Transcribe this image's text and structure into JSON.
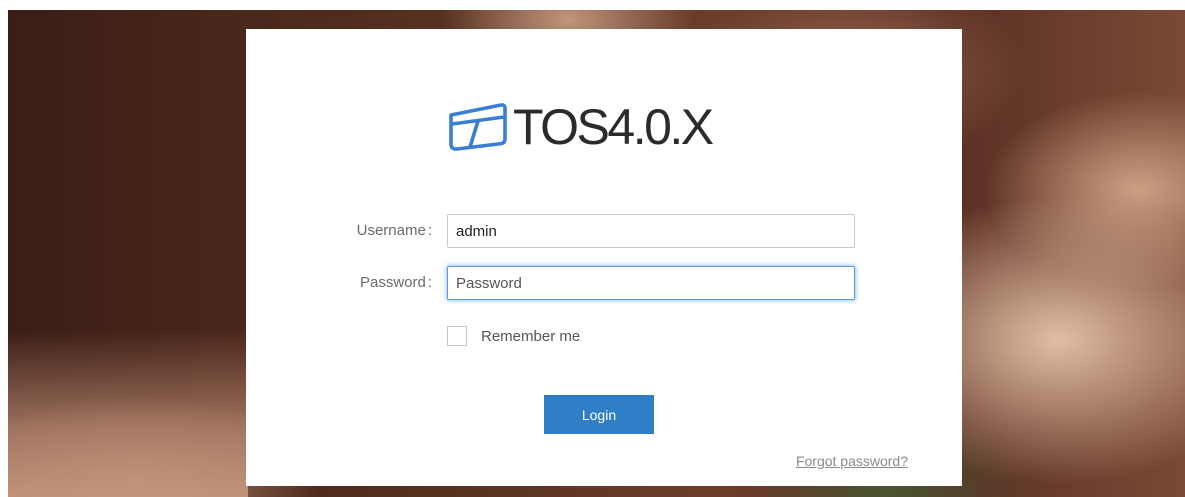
{
  "brand": {
    "logo_text": "TOS4.0.X",
    "logo_icon": "window-frame-icon",
    "accent_color": "#2f7fc7"
  },
  "form": {
    "username_label": "Username",
    "password_label": "Password",
    "label_colon": ":",
    "username_value": "admin",
    "password_placeholder": "Password",
    "remember_label": "Remember me",
    "remember_checked": false,
    "login_label": "Login",
    "forgot_label": "Forgot password?"
  }
}
